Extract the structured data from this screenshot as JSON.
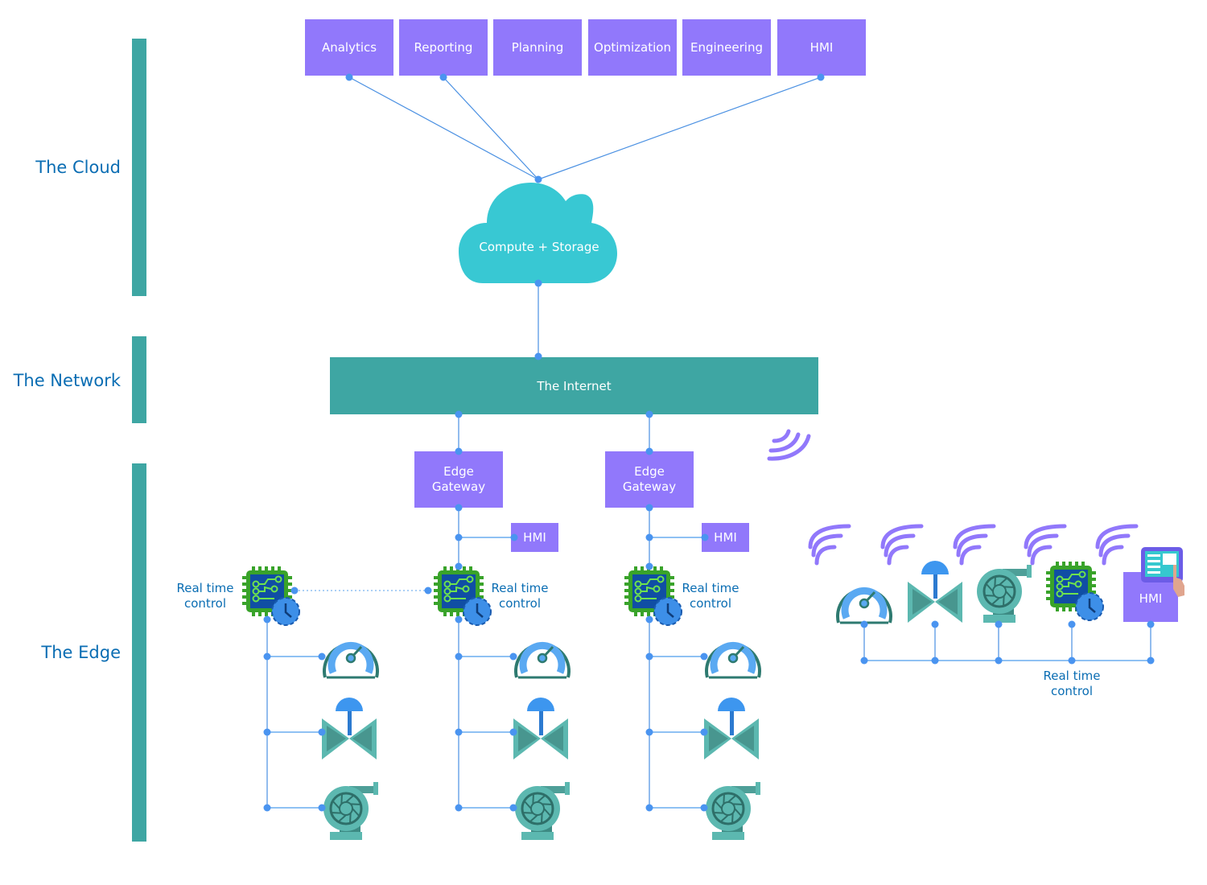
{
  "layers": [
    {
      "label": "The Cloud"
    },
    {
      "label": "The Network"
    },
    {
      "label": "The Edge"
    }
  ],
  "cloud_apps": [
    "Analytics",
    "Reporting",
    "Planning",
    "Optimization",
    "Engineering",
    "HMI"
  ],
  "cloud": {
    "label": "Compute + Storage"
  },
  "network": {
    "label": "The Internet"
  },
  "gateways": [
    {
      "label": "Edge Gateway",
      "hmi_label": "HMI"
    },
    {
      "label": "Edge Gateway",
      "hmi_label": "HMI"
    }
  ],
  "edge_columns": [
    {
      "controller_label": "Real time control",
      "devices": [
        "gauge",
        "valve",
        "pump"
      ]
    },
    {
      "controller_label": "Real time control",
      "devices": [
        "gauge",
        "valve",
        "pump"
      ]
    },
    {
      "controller_label": "Real time control",
      "devices": [
        "gauge",
        "valve",
        "pump"
      ]
    }
  ],
  "wireless_group": {
    "devices": [
      "gauge",
      "valve",
      "pump",
      "controller",
      "hmi"
    ],
    "hmi_label": "HMI",
    "bus_label": "Real time control"
  },
  "colors": {
    "purple": "#9178fb",
    "teal": "#3ea6a3",
    "cloud": "#38c8d3",
    "connector": "#4a90e2",
    "label_blue": "#0a6db3"
  }
}
